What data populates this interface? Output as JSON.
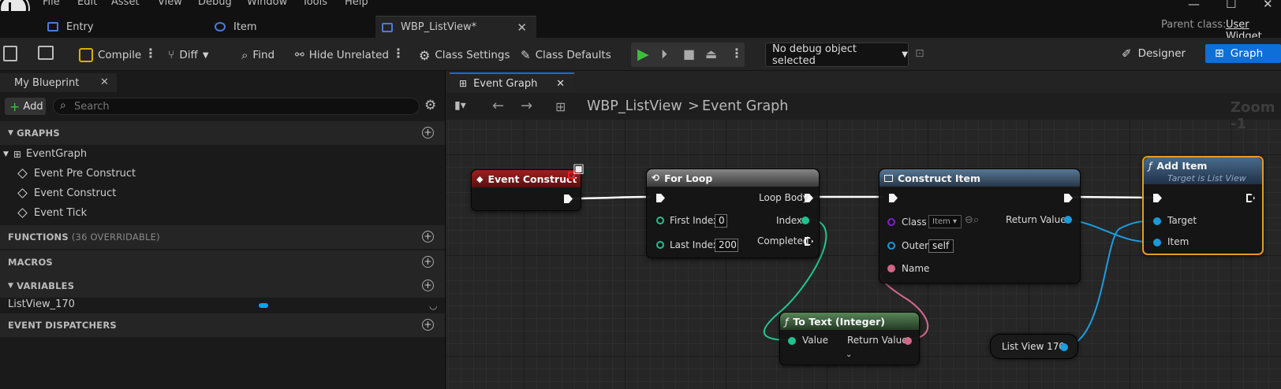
{
  "menu": [
    "File",
    "Edit",
    "Asset",
    "View",
    "Debug",
    "Window",
    "Tools",
    "Help"
  ],
  "window_controls": {
    "minimize": "—",
    "maximize": "☐",
    "close": "✕"
  },
  "tabs": [
    {
      "label": "Entry"
    },
    {
      "label": "Item"
    },
    {
      "label": "WBP_ListView*"
    }
  ],
  "parent_class": {
    "label": "Parent class:",
    "value": "User Widget"
  },
  "toolbar": {
    "compile": "Compile",
    "diff": "Diff",
    "find": "Find",
    "hide_unrelated": "Hide Unrelated",
    "class_settings": "Class Settings",
    "class_defaults": "Class Defaults",
    "debug_object": "No debug object selected",
    "designer": "Designer",
    "graph": "Graph"
  },
  "my_blueprint": {
    "tab_label": "My Blueprint",
    "add_label": "Add",
    "search_placeholder": "Search",
    "graphs_label": "GRAPHS",
    "event_graph": "EventGraph",
    "events": [
      "Event Pre Construct",
      "Event Construct",
      "Event Tick"
    ],
    "functions_label": "FUNCTIONS",
    "functions_sub": "(36 OVERRIDABLE)",
    "macros_label": "MACROS",
    "variables_label": "VARIABLES",
    "variable": "ListView_170",
    "dispatchers_label": "EVENT DISPATCHERS"
  },
  "graph": {
    "tab_label": "Event Graph",
    "breadcrumb_root": "WBP_ListView",
    "breadcrumb_sep": ">",
    "breadcrumb_leaf": "Event Graph",
    "zoom": "Zoom -1"
  },
  "nodes": {
    "event_construct": {
      "title": "Event Construct"
    },
    "for_loop": {
      "title": "For Loop",
      "first_index": "First Index",
      "first_index_value": "0",
      "last_index": "Last Index",
      "last_index_value": "200",
      "loop_body": "Loop Body",
      "index": "Index",
      "completed": "Completed"
    },
    "construct_item": {
      "title": "Construct Item",
      "class": "Class",
      "class_value": "Item",
      "outer": "Outer",
      "outer_value": "self",
      "name": "Name",
      "return_value": "Return Value"
    },
    "add_item": {
      "title": "Add Item",
      "subtitle": "Target is List View",
      "target": "Target",
      "item": "Item"
    },
    "to_text": {
      "title": "To Text (Integer)",
      "value": "Value",
      "return_value": "Return Value"
    },
    "list_view": {
      "label": "List View 170"
    }
  },
  "colors": {
    "accent": "#0e6fd8",
    "exec": "#ffffff",
    "object_pin": "#00a8f0",
    "int_pin": "#1fe0a0",
    "text_pin": "#e07090",
    "class_pin": "#8020d0",
    "event_header": "#8a1a1a",
    "function_header": "#3a5a78",
    "text_func_header": "#3a5a3a",
    "add_item_border": "#f0a020"
  },
  "icons": [
    "unreal-logo-icon",
    "save-icon",
    "browse-icon",
    "compile-icon",
    "diff-icon",
    "find-icon",
    "hide-unrelated-icon",
    "class-settings-icon",
    "class-defaults-icon",
    "play-icon",
    "step-icon",
    "stop-icon",
    "eject-icon",
    "designer-icon",
    "graph-icon",
    "search-icon",
    "settings-gear-icon"
  ]
}
